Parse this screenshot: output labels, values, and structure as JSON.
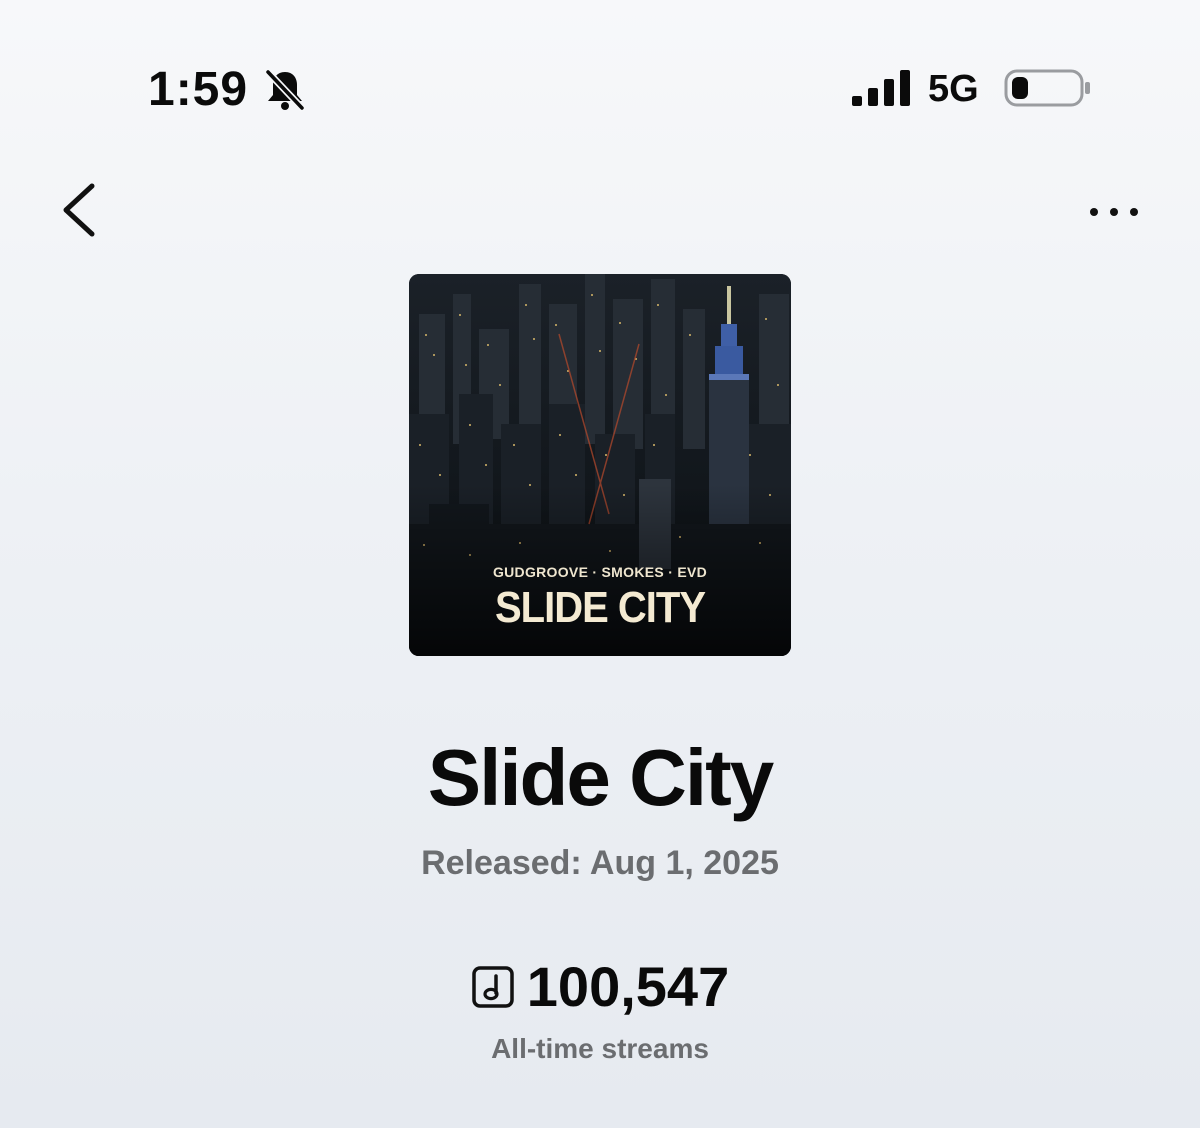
{
  "status_bar": {
    "time": "1:59",
    "network": "5G",
    "silent_mode": true,
    "signal_bars": 4,
    "battery_level": 0.25
  },
  "nav": {
    "back_icon": "chevron-left-icon",
    "more_icon": "ellipsis-icon"
  },
  "cover": {
    "artists_text": "GUDGROOVE · SMOKES · EVD",
    "title_text": "SLIDE CITY"
  },
  "track": {
    "title": "Slide City",
    "released": "Released: Aug 1, 2025",
    "stream_count": "100,547",
    "streams_label": "All-time streams"
  },
  "colors": {
    "background_top": "#f7f8fa",
    "background_bottom": "#e6eaf0",
    "primary_text": "#0a0a0a",
    "secondary_text": "#6b6d70",
    "cover_text": "#f4ead2"
  }
}
